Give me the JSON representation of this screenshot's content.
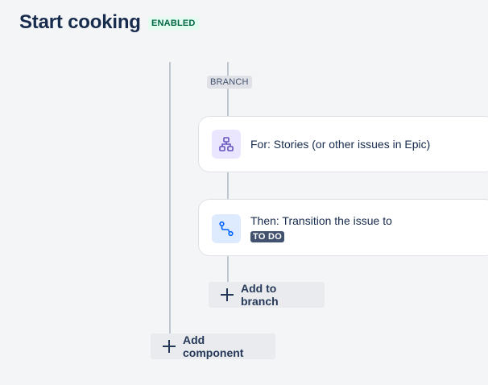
{
  "header": {
    "title": "Start cooking",
    "status_badge": "ENABLED"
  },
  "branch": {
    "tag": "BRANCH",
    "condition_card": {
      "icon": "hierarchy-icon",
      "text": "For: Stories (or other issues in Epic)"
    },
    "action_card": {
      "icon": "transition-icon",
      "text": "Then: Transition the issue to",
      "status": "TO DO"
    },
    "add_button": "Add to branch"
  },
  "add_component_button": "Add component",
  "colors": {
    "enabled_badge_bg": "#e3fcef",
    "enabled_badge_text": "#006644",
    "condition_icon_bg": "#eae6ff",
    "condition_icon_color": "#6554c0",
    "action_icon_bg": "#deebff",
    "action_icon_color": "#0065ff",
    "status_lozenge_bg": "#42526e"
  }
}
